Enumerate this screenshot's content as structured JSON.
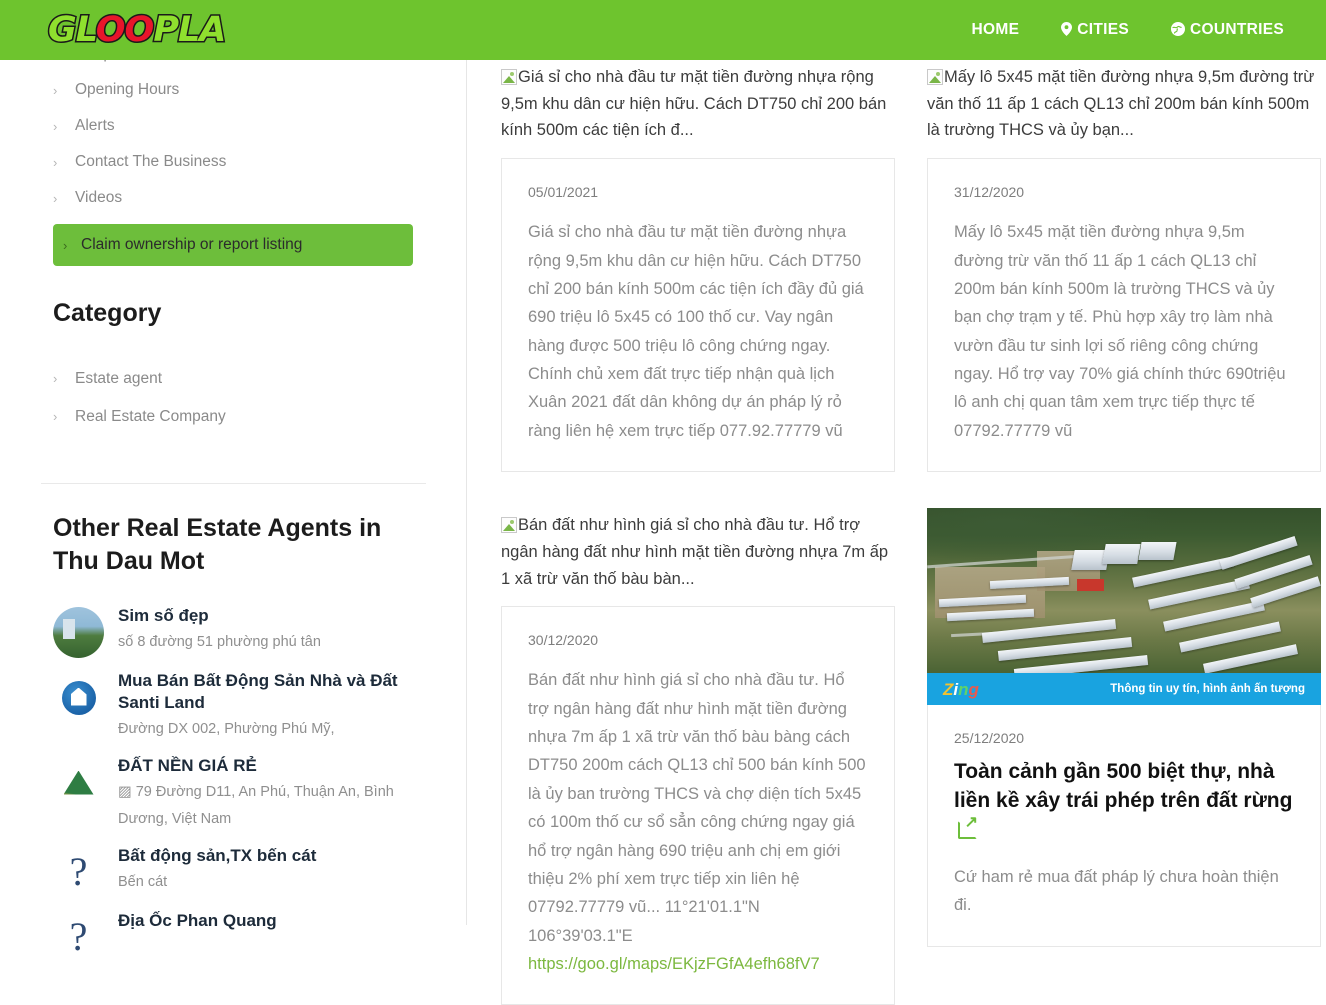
{
  "header": {
    "logo_text_part1": "GL",
    "logo_text_part2": "OO",
    "logo_text_part3": "PLA",
    "nav": [
      {
        "label": "HOME",
        "icon": ""
      },
      {
        "label": "CITIES",
        "icon": "map-pin"
      },
      {
        "label": "COUNTRIES",
        "icon": "globe"
      }
    ]
  },
  "sidebar": {
    "top_links": [
      {
        "label": "Telephone"
      },
      {
        "label": "Opening Hours"
      },
      {
        "label": "Alerts"
      },
      {
        "label": "Contact The Business"
      },
      {
        "label": "Videos"
      }
    ],
    "claim_link": "Claim ownership or report listing",
    "category_heading": "Category",
    "category_links": [
      {
        "label": "Estate agent"
      },
      {
        "label": "Real Estate Company"
      }
    ],
    "others_heading": "Other Real Estate Agents in Thu Dau Mot",
    "agents": [
      {
        "name": "Sim số đẹp",
        "address": "số 8 đường 51 phường phú tân",
        "avatar": "photo-building"
      },
      {
        "name": "Mua Bán Bất Động Sản Nhà và Đất Santi Land",
        "address": "Đường DX 002, Phường Phú Mỹ,",
        "avatar": "logo-santi-land"
      },
      {
        "name": "ĐẤT NỀN GIÁ RẺ",
        "address": "▨ 79 Đường D11, An Phú, Thuận An, Bình Dương, Việt Nam",
        "avatar": "logo-hoan-tam-phat"
      },
      {
        "name": "Bất động sản,TX bến cát",
        "address": "Bến cát",
        "avatar": "question-mark"
      },
      {
        "name": "Địa Ốc Phan Quang",
        "address": "",
        "avatar": "question-mark"
      }
    ]
  },
  "content": {
    "posts": [
      {
        "alt_text": "Giá sỉ cho nhà đầu tư mặt tiền đường nhựa rộng 9,5m khu dân cư hiện hữu. Cách DT750 chỉ 200 bán kính 500m các tiện ích đ...",
        "date": "05/01/2021",
        "body": "Giá sỉ cho nhà đầu tư mặt tiền đường nhựa rộng 9,5m khu dân cư hiện hữu. Cách DT750 chỉ 200 bán kính 500m các tiện ích đầy đủ giá 690 triệu lô 5x45 có 100 thố cư. Vay ngân hàng được 500 triệu lô công chứng ngay. Chính chủ xem đất trực tiếp nhận quà lịch Xuân 2021 đất dân không dự án pháp lý rỏ ràng liên hệ xem trực tiếp 077.92.77779 vũ"
      },
      {
        "alt_text": "Mấy lô 5x45 mặt tiền đường nhựa 9,5m đường trừ văn thố 11 ấp 1 cách QL13 chỉ 200m bán kính 500m là trường THCS và ủy bạn...",
        "date": "31/12/2020",
        "body": "Mấy lô 5x45 mặt tiền đường nhựa 9,5m đường trừ văn thố 11 ấp 1 cách QL13 chỉ 200m bán kính 500m là trường THCS và ủy bạn chợ trạm y tế. Phù hợp xây trọ làm nhà vườn đầu tư sinh lợi số riêng công chứng ngay. Hổ trợ vay 70% giá chính thức 690triệu lô anh chị quan tâm xem trực tiếp thực tế 07792.77779 vũ"
      },
      {
        "alt_text": "Bán đất như hình giá sỉ cho nhà đầu tư. Hổ trợ ngân hàng đất như hình mặt tiền đường nhựa 7m ấp 1 xã trừ văn thố bàu bàn...",
        "date": "30/12/2020",
        "body": "Bán đất như hình giá sỉ cho nhà đầu tư. Hổ trợ ngân hàng đất như hình mặt tiền đường nhựa 7m ấp 1 xã trừ văn thố bàu bàng cách DT750 200m cách QL13 chỉ 500 bán kính 500 là ủy ban trường THCS và chợ diện tích 5x45 có 100m thố cư sổ sẳn công chứng ngay giá hổ trợ ngân hàng 690 triệu anh chị em giới thiệu 2% phí xem trực tiếp xin liên hệ 07792.77779 vũ... 11°21'01.1\"N 106°39'03.1\"E ",
        "link": "https://goo.gl/maps/EKjzFGfA4efh68fV7"
      }
    ],
    "article": {
      "image_caption_logo": "Zing",
      "image_caption_text": "Thông tin uy tín, hình ảnh ấn tượng",
      "date": "25/12/2020",
      "title": "Toàn cảnh gần 500 biệt thự, nhà liền kề xây trái phép trên đất rừng",
      "description": "Cứ ham rẻ mua đất pháp lý chưa hoàn thiện đi."
    }
  },
  "colors": {
    "header_green": "#6ec42e",
    "button_green": "#6dbe3b",
    "link_green": "#7cb83f",
    "zing_blue": "#19a3e0"
  }
}
